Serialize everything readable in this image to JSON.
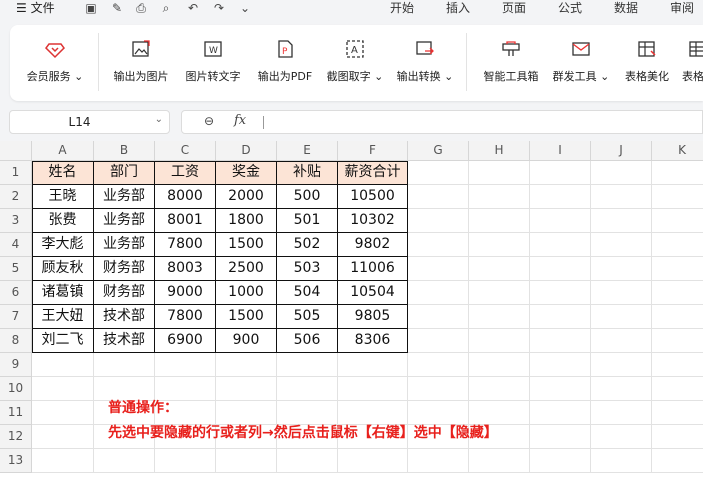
{
  "menu": {
    "file": "☰ 文件",
    "tabs": [
      "开始",
      "插入",
      "页面",
      "公式",
      "数据",
      "审阅"
    ]
  },
  "ribbon": {
    "buttons": [
      {
        "label": "会员服务",
        "icon": "diamond-icon",
        "dropdown": true
      },
      {
        "label": "输出为图片",
        "icon": "image-export-icon"
      },
      {
        "label": "图片转文字",
        "icon": "image-to-text-icon"
      },
      {
        "label": "输出为PDF",
        "icon": "pdf-export-icon"
      },
      {
        "label": "截图取字",
        "icon": "screenshot-text-icon",
        "dropdown": true
      },
      {
        "label": "输出转换",
        "icon": "convert-icon",
        "dropdown": true
      },
      {
        "label": "智能工具箱",
        "icon": "toolbox-icon"
      },
      {
        "label": "群发工具",
        "icon": "mail-icon",
        "dropdown": true
      },
      {
        "label": "表格美化",
        "icon": "table-style-icon"
      },
      {
        "label": "表格",
        "icon": "table-icon"
      }
    ]
  },
  "formula": {
    "cell_ref": "L14",
    "zoom_symbol": "⊖",
    "fx": "fx",
    "value": ""
  },
  "sheet": {
    "columns": [
      "A",
      "B",
      "C",
      "D",
      "E",
      "F",
      "G",
      "H",
      "I",
      "J",
      "K"
    ],
    "rows": [
      "1",
      "2",
      "3",
      "4",
      "5",
      "6",
      "7",
      "8",
      "9",
      "10",
      "11",
      "12",
      "13"
    ],
    "table": {
      "headers": [
        "姓名",
        "部门",
        "工资",
        "奖金",
        "补贴",
        "薪资合计"
      ],
      "rows": [
        [
          "王晓",
          "业务部",
          "8000",
          "2000",
          "500",
          "10500"
        ],
        [
          "张费",
          "业务部",
          "8001",
          "1800",
          "501",
          "10302"
        ],
        [
          "李大彪",
          "业务部",
          "7800",
          "1500",
          "502",
          "9802"
        ],
        [
          "顾友秋",
          "财务部",
          "8003",
          "2500",
          "503",
          "11006"
        ],
        [
          "诸葛镇",
          "财务部",
          "9000",
          "1000",
          "504",
          "10504"
        ],
        [
          "王大妞",
          "技术部",
          "7800",
          "1500",
          "505",
          "9805"
        ],
        [
          "刘二飞",
          "技术部",
          "6900",
          "900",
          "506",
          "8306"
        ]
      ],
      "header_fill": "#fce4d6"
    },
    "notes": [
      "普通操作：",
      "先选中要隐藏的行或者列→然后点击鼠标【右键】选中【隐藏】"
    ],
    "note_color": "#e8201c"
  }
}
